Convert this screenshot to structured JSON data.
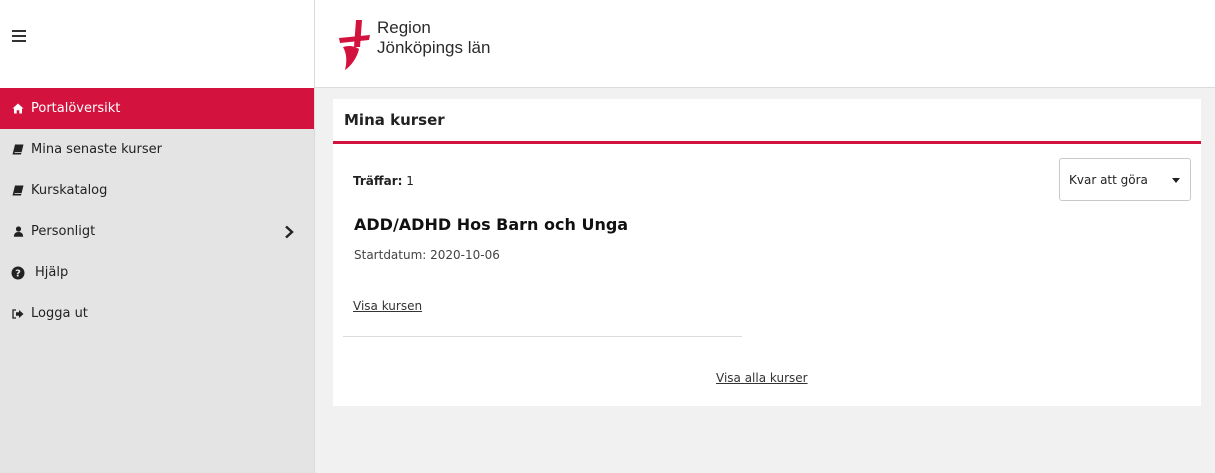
{
  "brand": {
    "name_line1": "Region",
    "name_line2": "Jönköpings län",
    "color": "#d3133d"
  },
  "sidebar": {
    "menu_icon": "hamburger-icon",
    "items": [
      {
        "label": "Portalöversikt",
        "icon": "home-icon",
        "active": true
      },
      {
        "label": "Mina senaste kurser",
        "icon": "book-icon"
      },
      {
        "label": "Kurskatalog",
        "icon": "book-icon"
      },
      {
        "label": "Personligt",
        "icon": "user-icon",
        "has_submenu": true
      },
      {
        "label": "Hjälp",
        "icon": "question-circle-icon"
      },
      {
        "label": "Logga ut",
        "icon": "sign-out-icon"
      }
    ]
  },
  "main": {
    "title": "Mina kurser",
    "hits_label": "Träffar:",
    "hits_count": "1",
    "filter": {
      "selected": "Kvar att göra"
    },
    "courses": [
      {
        "title": "ADD/ADHD Hos Barn och Unga",
        "start_text": "Startdatum: 2020-10-06",
        "link_label": "Visa kursen"
      }
    ],
    "show_all_label": "Visa alla kurser"
  }
}
